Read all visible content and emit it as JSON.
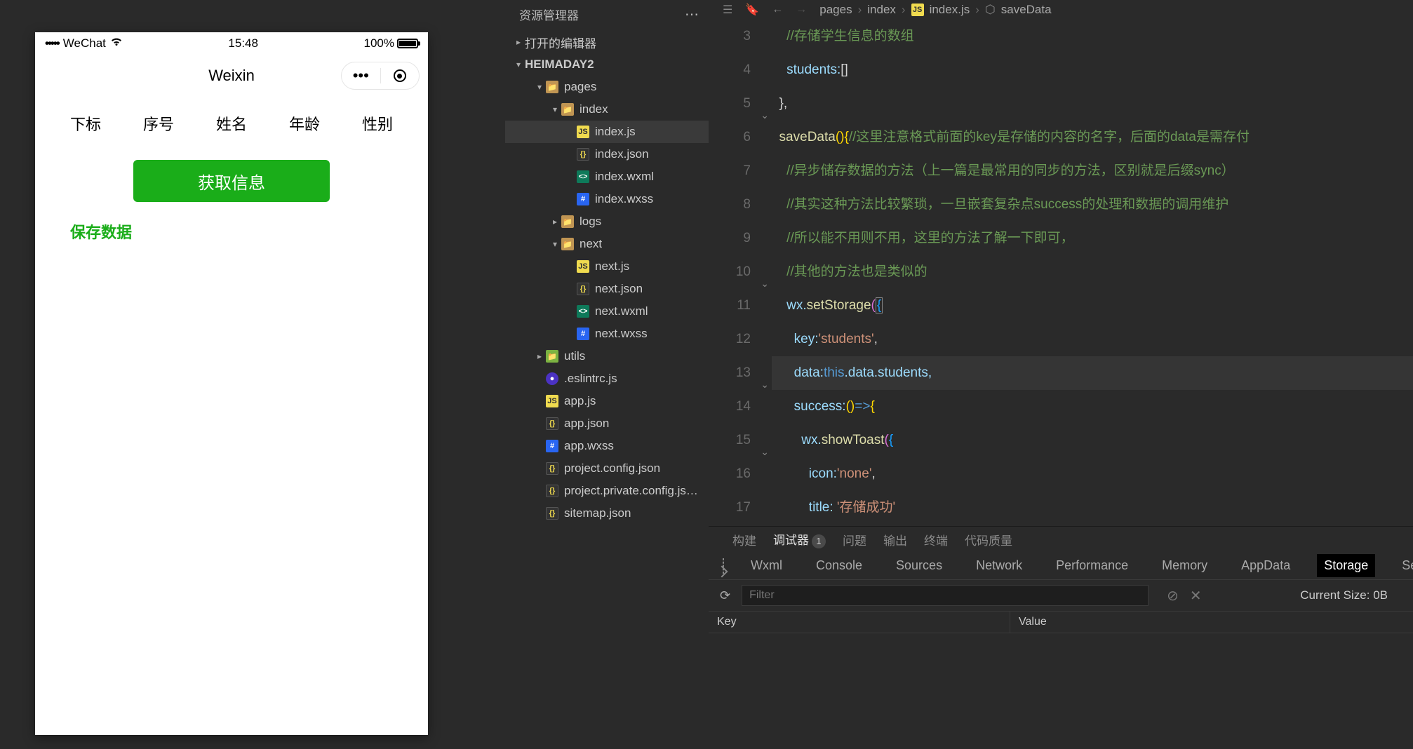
{
  "simulator": {
    "status": {
      "carrier": "WeChat",
      "time": "15:48",
      "battery_pct": "100%",
      "signal_dots": "•••••"
    },
    "nav_title": "Weixin",
    "capsule_dots": "•••",
    "columns": [
      "下标",
      "序号",
      "姓名",
      "年龄",
      "性别"
    ],
    "fetch_btn": "获取信息",
    "save_link": "保存数据"
  },
  "explorer": {
    "title": "资源管理器",
    "sections": {
      "open_editors": "打开的编辑器",
      "project": "HEIMADAY2"
    },
    "tree": [
      {
        "indent": 1,
        "chev": "▾",
        "icon": "folder",
        "label": "pages"
      },
      {
        "indent": 2,
        "chev": "▾",
        "icon": "folder",
        "label": "index"
      },
      {
        "indent": 3,
        "chev": "",
        "icon": "js",
        "label": "index.js",
        "selected": true
      },
      {
        "indent": 3,
        "chev": "",
        "icon": "json",
        "label": "index.json"
      },
      {
        "indent": 3,
        "chev": "",
        "icon": "wxml",
        "label": "index.wxml"
      },
      {
        "indent": 3,
        "chev": "",
        "icon": "wxss",
        "label": "index.wxss"
      },
      {
        "indent": 2,
        "chev": "▸",
        "icon": "folder",
        "label": "logs"
      },
      {
        "indent": 2,
        "chev": "▾",
        "icon": "folder",
        "label": "next"
      },
      {
        "indent": 3,
        "chev": "",
        "icon": "js",
        "label": "next.js"
      },
      {
        "indent": 3,
        "chev": "",
        "icon": "json",
        "label": "next.json"
      },
      {
        "indent": 3,
        "chev": "",
        "icon": "wxml",
        "label": "next.wxml"
      },
      {
        "indent": 3,
        "chev": "",
        "icon": "wxss",
        "label": "next.wxss"
      },
      {
        "indent": 1,
        "chev": "▸",
        "icon": "folder-g",
        "label": "utils"
      },
      {
        "indent": 1,
        "chev": "",
        "icon": "eslint",
        "label": ".eslintrc.js"
      },
      {
        "indent": 1,
        "chev": "",
        "icon": "js",
        "label": "app.js"
      },
      {
        "indent": 1,
        "chev": "",
        "icon": "json",
        "label": "app.json"
      },
      {
        "indent": 1,
        "chev": "",
        "icon": "wxss",
        "label": "app.wxss"
      },
      {
        "indent": 1,
        "chev": "",
        "icon": "json",
        "label": "project.config.json"
      },
      {
        "indent": 1,
        "chev": "",
        "icon": "json",
        "label": "project.private.config.js…"
      },
      {
        "indent": 1,
        "chev": "",
        "icon": "json",
        "label": "sitemap.json"
      }
    ]
  },
  "editor": {
    "breadcrumbs": [
      "pages",
      "index",
      "index.js",
      "saveData"
    ],
    "line_numbers": [
      "3",
      "4",
      "5",
      "6",
      "7",
      "8",
      "9",
      "10",
      "11",
      "12",
      "13",
      "14",
      "15",
      "16",
      "17"
    ],
    "folds": [
      {
        "line": 5,
        "glyph": "⌄"
      },
      {
        "line": 10,
        "glyph": "⌄"
      },
      {
        "line": 13,
        "glyph": "⌄"
      },
      {
        "line": 15,
        "glyph": "⌄"
      }
    ],
    "code": {
      "l3": "    //存储学生信息的数组",
      "l4_a": "    students:",
      "l4_b": "[]",
      "l5": "  },",
      "l6_a": "  saveData",
      "l6_b": "()",
      "l6_c": "{",
      "l6_d": "//这里注意格式前面的key是存储的内容的名字，后面的data是需存付",
      "l7": "    //异步储存数据的方法（上一篇是最常用的同步的方法，区别就是后缀sync）",
      "l8": "    //其实这种方法比较繁琐，一旦嵌套复杂点success的处理和数据的调用维护",
      "l9": "    //所以能不用则不用，这里的方法了解一下即可，",
      "l10": "    //其他的方法也是类似的",
      "l11_a": "    wx.",
      "l11_b": "setStorage",
      "l11_c": "(",
      "l11_d": "{",
      "l12_a": "      key:",
      "l12_b": "'students'",
      "l12_c": ",",
      "l13_a": "      data:",
      "l13_b": "this",
      "l13_c": ".data.students,",
      "l14_a": "      success:",
      "l14_b": "()",
      "l14_c": "=>",
      "l14_d": "{",
      "l15_a": "        wx.",
      "l15_b": "showToast",
      "l15_c": "(",
      "l15_d": "{",
      "l16_a": "          icon:",
      "l16_b": "'none'",
      "l16_c": ",",
      "l17_a": "          title: ",
      "l17_b": "'存储成功'"
    }
  },
  "panel": {
    "tabs1": [
      "构建",
      "调试器",
      "问题",
      "输出",
      "终端",
      "代码质量"
    ],
    "tabs1_badge": "1",
    "tabs2": [
      "Wxml",
      "Console",
      "Sources",
      "Network",
      "Performance",
      "Memory",
      "AppData",
      "Storage",
      "Security"
    ],
    "filter_placeholder": "Filter",
    "size_label": "Current Size: 0B",
    "kv": {
      "key": "Key",
      "value": "Value"
    }
  }
}
